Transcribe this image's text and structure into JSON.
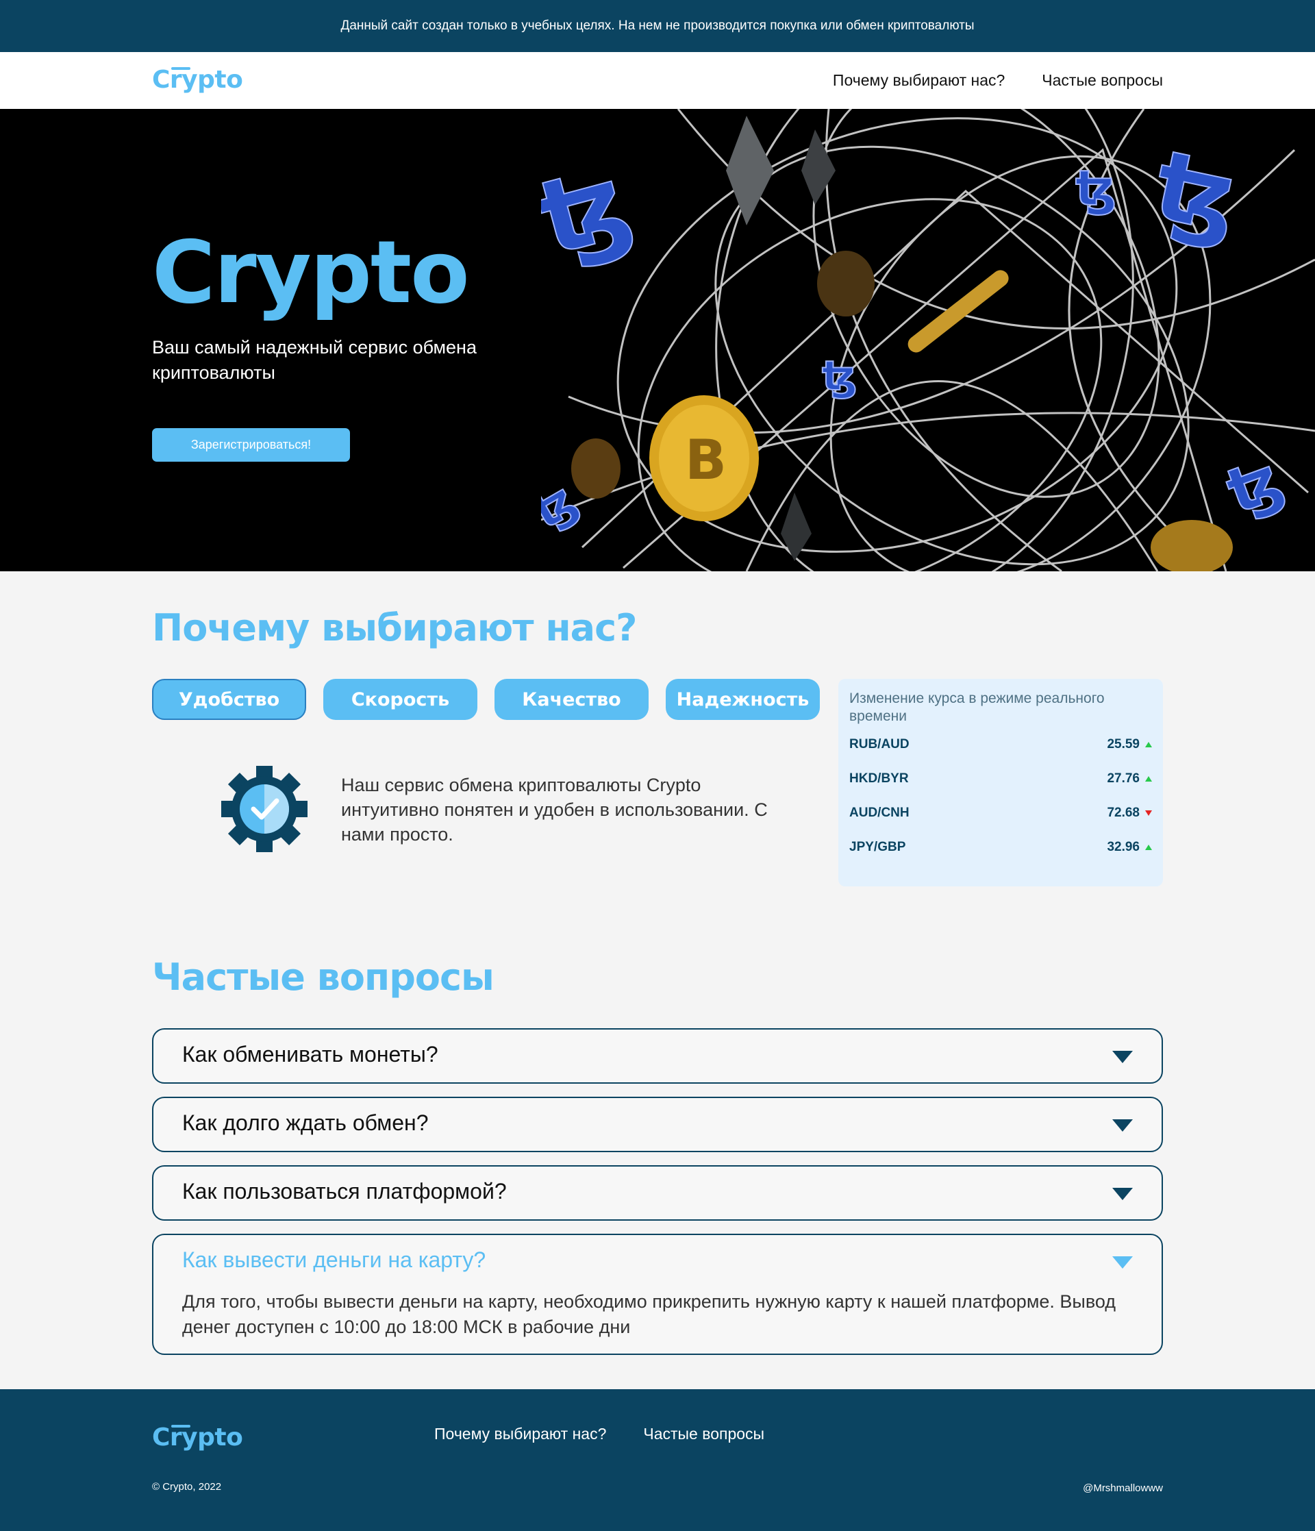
{
  "notice": "Данный сайт создан только в учебных целях. На нем не производится покупка или обмен криптовалюты",
  "brand": "Crypto",
  "nav": {
    "why": "Почему выбирают нас?",
    "faq": "Частые вопросы"
  },
  "hero": {
    "title": "Crypto",
    "subtitle": "Ваш самый надежный сервис обмена криптовалюты",
    "button": "Зарегистрироваться!"
  },
  "why": {
    "title": "Почему выбирают нас?",
    "tabs": [
      "Удобство",
      "Скорость",
      "Качество",
      "Надежность"
    ],
    "active_tab": "Удобство",
    "feature_icon": "gear-check-icon",
    "feature_text": "Наш сервис обмена криптовалюты Crypto интуитивно понятен и удобен в использовании. С нами просто."
  },
  "rates": {
    "title": "Изменение курса в режиме реального времени",
    "items": [
      {
        "pair": "RUB/AUD",
        "value": "25.59",
        "trend": "up"
      },
      {
        "pair": "HKD/BYR",
        "value": "27.76",
        "trend": "up"
      },
      {
        "pair": "AUD/CNH",
        "value": "72.68",
        "trend": "down"
      },
      {
        "pair": "JPY/GBP",
        "value": "32.96",
        "trend": "up"
      }
    ]
  },
  "faq": {
    "title": "Частые вопросы",
    "items": [
      {
        "question": "Как обменивать монеты?",
        "open": false
      },
      {
        "question": "Как долго ждать обмен?",
        "open": false
      },
      {
        "question": "Как пользоваться платформой?",
        "open": false
      },
      {
        "question": "Как вывести деньги на карту?",
        "open": true,
        "answer": "Для того, чтобы вывести деньги на карту, необходимо прикрепить нужную карту к нашей платформе. Вывод денег доступен с 10:00 до 18:00 МСК в рабочие дни"
      }
    ]
  },
  "footer": {
    "copyright": "© Crypto, 2022",
    "handle": "@Mrshmallowww"
  },
  "colors": {
    "brand": "#5bbef3",
    "dark": "#0b4461",
    "rate_up": "#27c94b",
    "rate_down": "#e42424"
  }
}
